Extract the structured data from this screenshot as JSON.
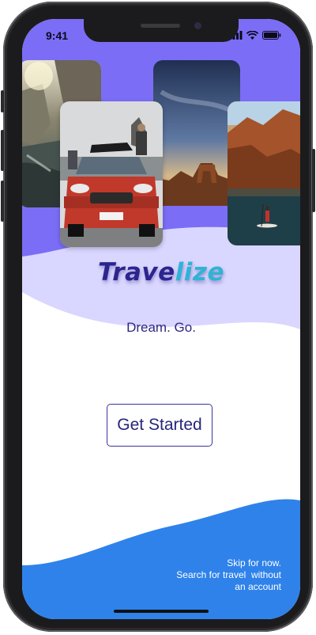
{
  "status_bar": {
    "time": "9:41"
  },
  "brand": {
    "name_part1": "Trave",
    "name_part2": "lize"
  },
  "tagline": "Dream. Go.",
  "actions": {
    "get_started_label": "Get Started",
    "skip_line1": "Skip for now.",
    "skip_line2": "Search for travel  without",
    "skip_line3": "an account"
  },
  "colors": {
    "header_purple": "#7b6df6",
    "wave_lavender": "#d9d6ff",
    "footer_blue": "#2f82ea",
    "logo_navy": "#2c258e",
    "logo_teal": "#31b3d4"
  },
  "icons": [
    "cellular-signal-icon",
    "wifi-icon",
    "battery-icon"
  ]
}
